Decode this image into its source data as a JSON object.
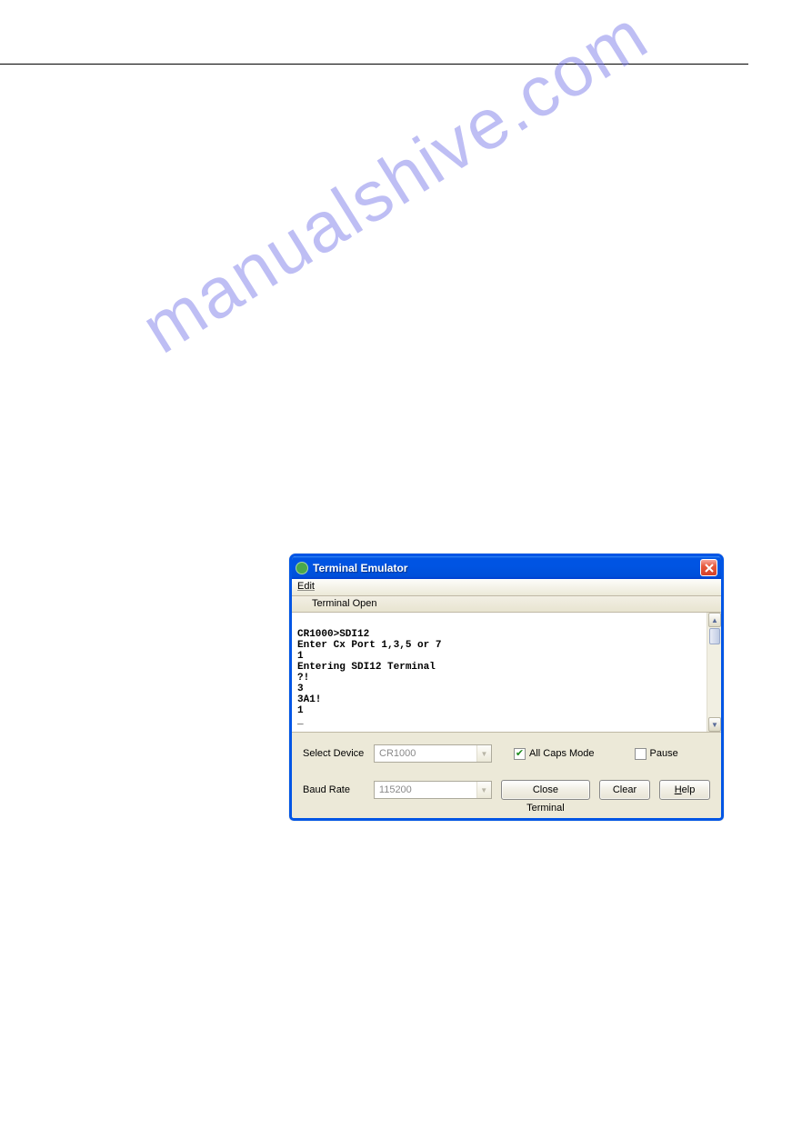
{
  "watermark": "manualshive.com",
  "window": {
    "title": "Terminal Emulator",
    "menu": {
      "edit": "Edit"
    },
    "status": "Terminal Open",
    "terminal_lines": "CR1000>SDI12\nEnter Cx Port 1,3,5 or 7\n1\nEntering SDI12 Terminal\n?!\n3\n3A1!\n1\n_",
    "fields": {
      "select_device_label": "Select Device",
      "select_device_value": "CR1000",
      "baud_rate_label": "Baud Rate",
      "baud_rate_value": "115200"
    },
    "checkboxes": {
      "all_caps": {
        "label": "All Caps Mode",
        "checked": true
      },
      "pause": {
        "label": "Pause",
        "checked": false
      }
    },
    "buttons": {
      "close_terminal": "Close Terminal",
      "clear": "Clear",
      "help": "Help",
      "help_underline": "H"
    }
  }
}
